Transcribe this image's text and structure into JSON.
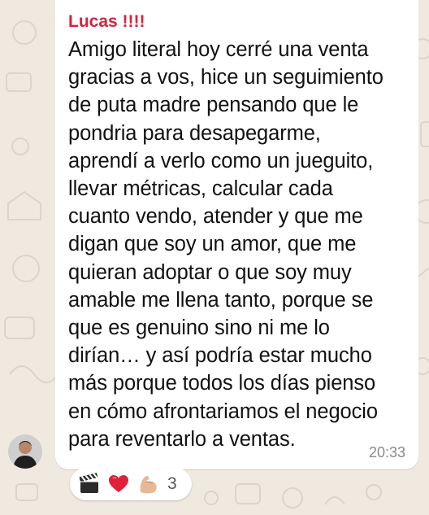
{
  "message": {
    "sender": "Lucas !!!!",
    "text": "Amigo literal hoy cerré una venta\ngracias a vos, hice un seguimiento\nde puta madre pensando que le\npondria para desapegarme,\naprendí a verlo como un jueguito,\nllevar métricas, calcular cada\ncuanto vendo, atender y que me\ndigan que soy un amor, que me\nquieran adoptar o que soy muy\namable me llena tanto, porque se\nque es genuino sino ni me lo\ndirían… y así podría estar mucho\nmás porque todos los días pienso\nen cómo afrontariamos el negocio\npara reventarlo a ventas.",
    "time": "20:33"
  },
  "reactions": {
    "icons": [
      "clapperboard-icon",
      "red-heart-icon",
      "flexed-biceps-icon"
    ],
    "count": "3"
  },
  "colors": {
    "sender": "#d4243b",
    "bubble": "#ffffff",
    "wallpaper": "#efe9df"
  }
}
